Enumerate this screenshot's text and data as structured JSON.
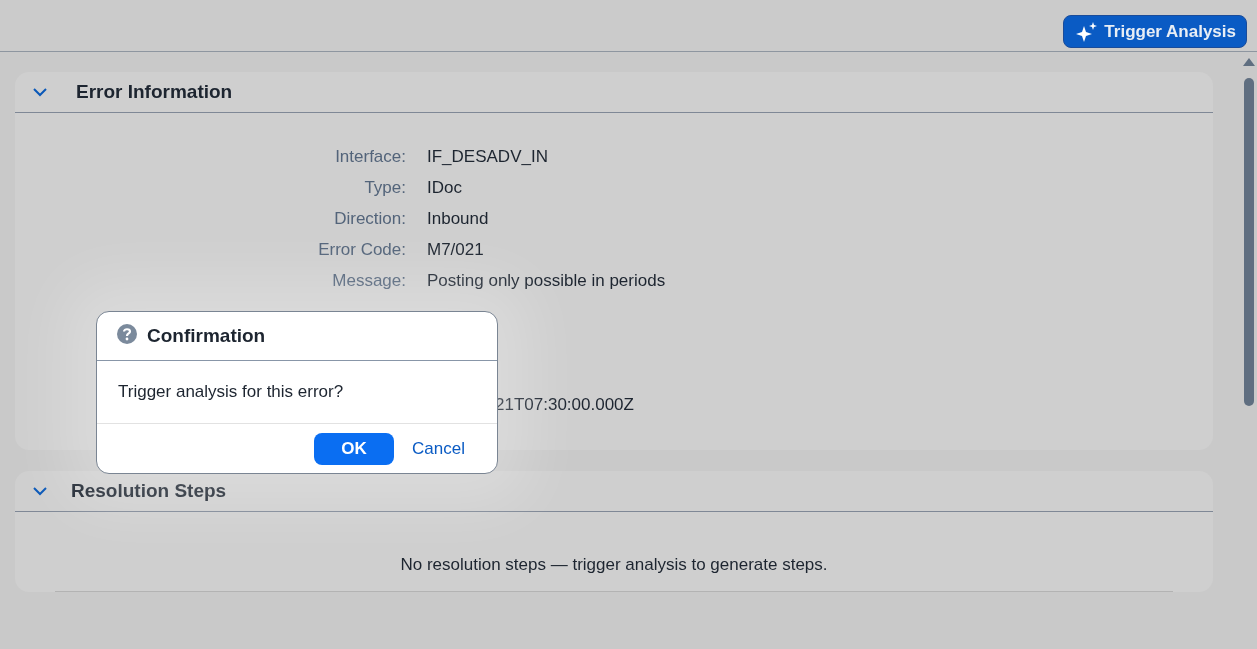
{
  "toolbar": {
    "button": "Trigger Analysis"
  },
  "panels": [
    {
      "kind": "fields",
      "title": "Error Information",
      "expanded": true,
      "rows": [
        {
          "label": "Interface:",
          "value": "IF_DESADV_IN"
        },
        {
          "label": "Type:",
          "value": "IDoc"
        },
        {
          "label": "Direction:",
          "value": "Inbound"
        },
        {
          "label": "Error Code:",
          "value": "M7/021"
        },
        {
          "label": "Message:",
          "value": "Posting only possible in periods"
        },
        {
          "kind": "hidden"
        },
        {
          "kind": "hidden"
        },
        {
          "kind": "hidden"
        },
        {
          "kind": "partial",
          "value": "21T07:30:00.000Z"
        }
      ]
    },
    {
      "kind": "empty",
      "title": "Resolution Steps",
      "expanded": true,
      "message": "No resolution steps — trigger analysis to generate steps."
    }
  ],
  "dialog": {
    "title": "Confirmation",
    "message": "Trigger analysis for this error?",
    "buttons": [
      {
        "label": "OK",
        "kind": "primary"
      },
      {
        "label": "Cancel",
        "kind": "transparent"
      }
    ]
  }
}
